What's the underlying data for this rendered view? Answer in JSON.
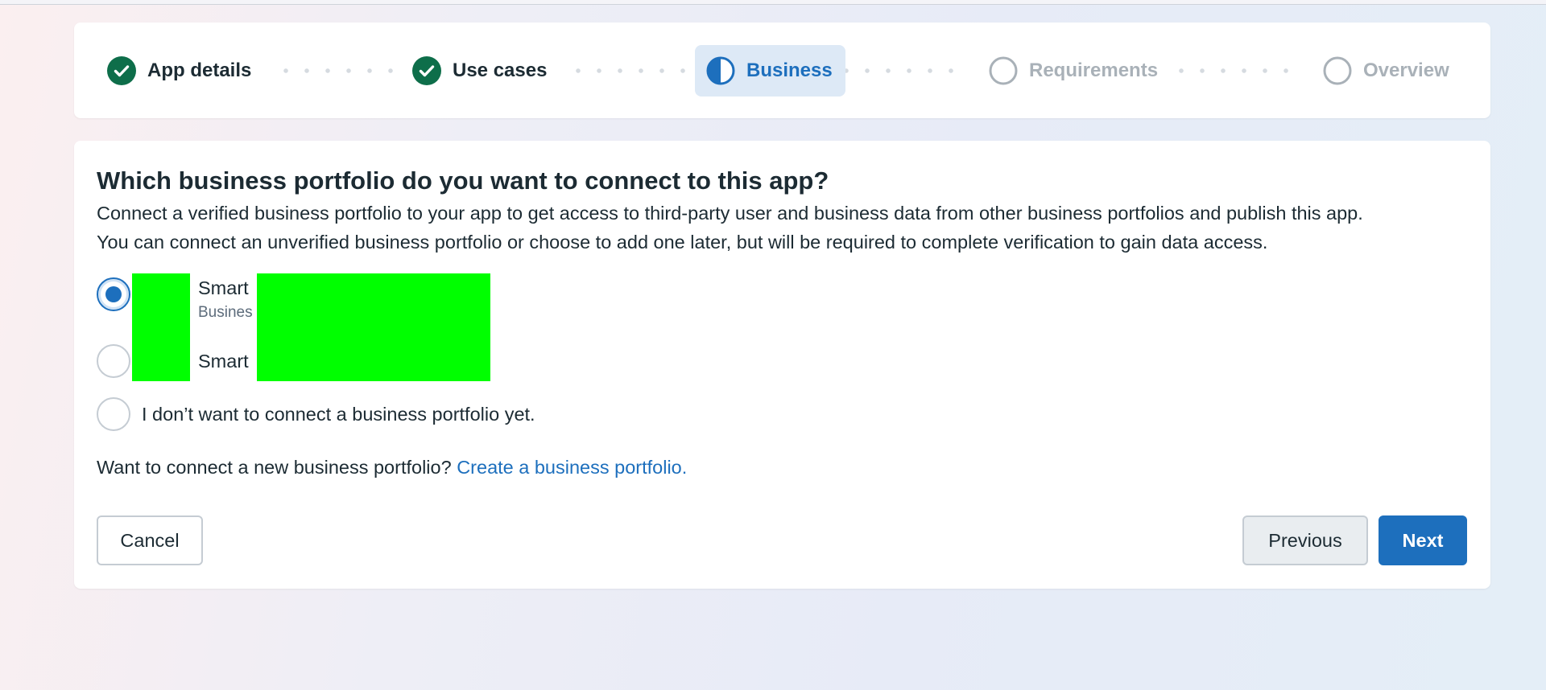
{
  "stepper": {
    "steps": [
      {
        "label": "App details",
        "state": "done"
      },
      {
        "label": "Use cases",
        "state": "done"
      },
      {
        "label": "Business",
        "state": "active"
      },
      {
        "label": "Requirements",
        "state": "todo"
      },
      {
        "label": "Overview",
        "state": "todo"
      }
    ]
  },
  "main": {
    "title": "Which business portfolio do you want to connect to this app?",
    "description_line1": "Connect a verified business portfolio to your app to get access to third-party user and business data from other business portfolios and publish this app.",
    "description_line2": "You can connect an unverified business portfolio or choose to add one later, but will be required to complete verification to gain data access.",
    "options": [
      {
        "name": "Smart",
        "subtitle": "Busines",
        "selected": true
      },
      {
        "name": "Smart",
        "subtitle": "",
        "selected": false
      },
      {
        "name": "I don’t want to connect a business portfolio yet.",
        "selected": false
      }
    ],
    "connect_prompt": "Want to connect a new business portfolio?",
    "connect_link": "Create a business portfolio."
  },
  "footer": {
    "cancel_label": "Cancel",
    "previous_label": "Previous",
    "next_label": "Next"
  },
  "colors": {
    "accent": "#1d6fbd",
    "done_green": "#0e6e4a",
    "redaction": "#00ff00"
  },
  "icons": {
    "done": "check-circle-icon",
    "active": "half-circle-icon",
    "todo": "empty-circle-icon"
  }
}
